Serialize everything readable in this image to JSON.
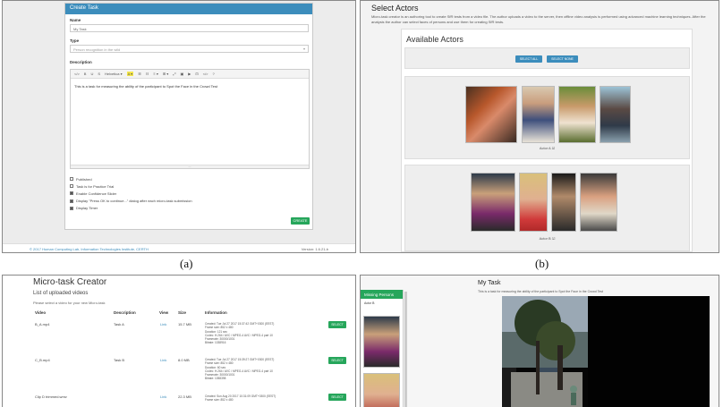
{
  "a": {
    "dialog_title": "Create Task",
    "name_label": "Name",
    "name_value": "My Task",
    "type_label": "Type",
    "type_value": "Person recognition in the wild",
    "description_label": "Description",
    "toolbar": [
      "</>",
      "B",
      "U",
      "S",
      "Helvetica ▾",
      "A ▾",
      "☰",
      "☷",
      "≡ ▾",
      "⊞ ▾",
      "⤢",
      "▣",
      "▶",
      "⊡",
      "</>",
      "?"
    ],
    "description_text": "This is a task for measuring the ability of the participant to Spot the Face in the Crowd Test",
    "options": [
      {
        "label": "Published",
        "checked": false
      },
      {
        "label": "Task is for Practice Trial",
        "checked": false
      },
      {
        "label": "Enable Confidence Slider",
        "checked": true
      },
      {
        "label": "Display \"Press OK to continue...\" dialog after each micro-task submission",
        "checked": true
      },
      {
        "label": "Display Timer",
        "checked": true
      }
    ],
    "create_label": "CREATE",
    "footer_text": "© 2017 Human Computing Lab, Information Technologies Institute, CERTH",
    "footer_version": "Version: 1.6.21-b"
  },
  "b": {
    "title": "Select Actors",
    "desc": "Micro-task creator is an authoring tool to create SfR tests from a video file. The author uploads a video to the server, then offline video analysis is performed using advanced machine learning techniques. After the analysis the author can select faces of persons and use them for creating SfR tests.",
    "heading": "Available Actors",
    "select_all": "SELECT ALL",
    "select_none": "SELECT NONE",
    "actors": [
      {
        "label": "Actor A ☑"
      },
      {
        "label": "Actor B ☑"
      }
    ]
  },
  "c": {
    "title": "Micro-task Creator",
    "subtitle": "List of uploaded videos",
    "hint": "Please select a video for your new Micro-task",
    "headers": [
      "Video",
      "Description",
      "View",
      "Size",
      "Information"
    ],
    "rows": [
      {
        "video": "B_A.mp4",
        "desc": "Task A",
        "view": "Link",
        "size": "15.7 MB",
        "info": [
          "Created: Tue Jul 27 2017 15:37:42 GMT+0300 (EEST)",
          "Frame size: 852 x 480",
          "Duration: 121 sec",
          "Codec: H.264 / AVC / MPEG-4 AVC / MPEG-4 part 10",
          "Framerate: 30000/1001",
          "Bitrate: 1038916"
        ],
        "btn": "SELECT"
      },
      {
        "video": "C_B.mp4",
        "desc": "Task B",
        "view": "Link",
        "size": "8.0 MB",
        "info": [
          "Created: Tue Jul 27 2017 15:39:27 GMT+0300 (EEST)",
          "Frame size: 852 x 480",
          "Duration: 60 sec",
          "Codec: H.264 / AVC / MPEG-4 AVC / MPEG-4 part 10",
          "Framerate: 30000/1001",
          "Bitrate: 1058398"
        ],
        "btn": "SELECT"
      },
      {
        "video": "Clip D trimmed.wmv",
        "desc": "",
        "view": "Link",
        "size": "22.3 MB",
        "info": [
          "Created: Sun Aug 20 2017 10:31:09 GMT+0300 (EEST)",
          "Frame size: 852 x 480"
        ],
        "btn": "SELECT"
      }
    ]
  },
  "d": {
    "missing": "Missing Persons",
    "actor": "Actor B",
    "title": "My Task",
    "desc": "This is a task for measuring the ability of the participant to Spot the Face in the Crowd Test"
  },
  "captions": {
    "a": "(a)",
    "b": "(b)"
  }
}
